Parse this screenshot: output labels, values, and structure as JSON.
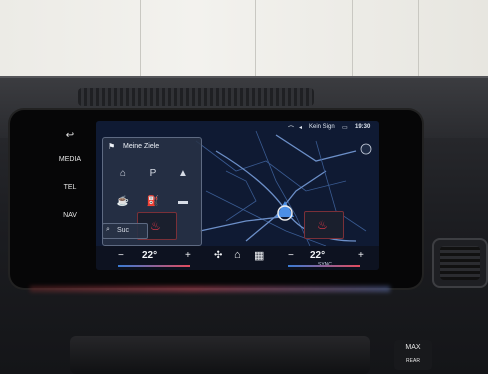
{
  "screen": {
    "status": {
      "items": [
        {
          "text": "19:30",
          "name": "clock-text"
        },
        {
          "text": "Kein Sign",
          "name": "signal-status-text"
        }
      ]
    },
    "panel": {
      "title": "Meine Ziele",
      "grid_icons": [
        "car-icon",
        "parking-icon",
        "restaurant-icon",
        "coffee-icon",
        "fuel-icon",
        "hotel-icon"
      ],
      "search_label": "Suc"
    },
    "climate": {
      "left_temp": "22°",
      "right_temp": "22°",
      "minus": "−",
      "plus": "+",
      "sync_label": "SYNC"
    }
  },
  "hardkeys": {
    "back": "↩",
    "media": "MEDIA",
    "tel": "TEL",
    "nav": "NAV"
  },
  "console": {
    "max_label": "MAX",
    "rear_label": "REAR"
  }
}
